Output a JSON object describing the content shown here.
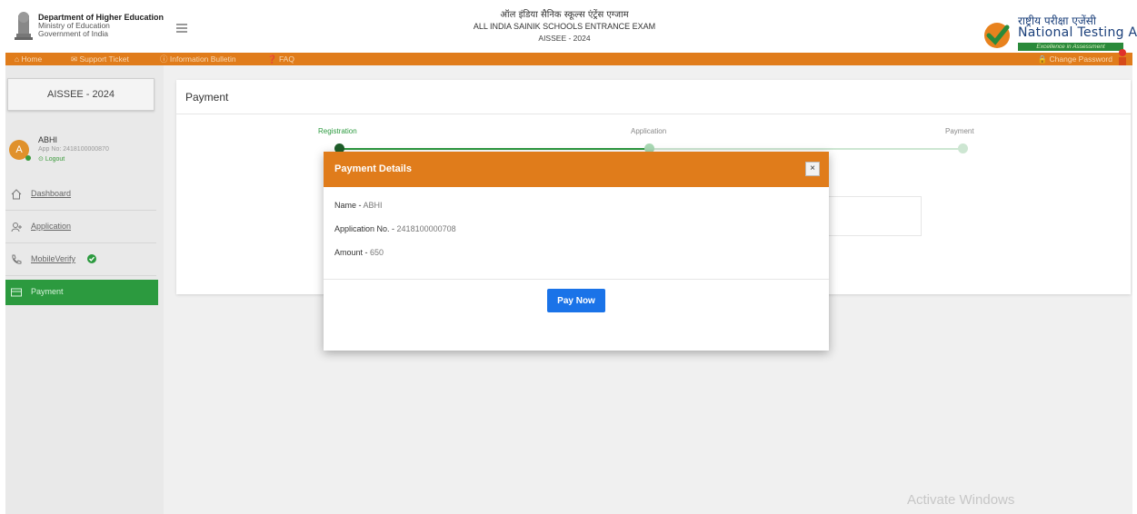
{
  "header": {
    "dept_line1": "Department of Higher Education",
    "dept_line2": "Ministry of Education",
    "dept_line3": "Government of India",
    "exam_hindi": "ऑल इंडिया सैनिक स्कूल्स एंट्रेंस एग्जाम",
    "exam_english": "ALL INDIA SAINIK SCHOOLS ENTRANCE EXAM",
    "exam_code": "AISSEE - 2024",
    "nta_hindi": "राष्ट्रीय परीक्षा एजेंसी",
    "nta_english": "National Testing Agency",
    "nta_tagline": "Excellence in Assessment"
  },
  "navbar": {
    "home": "Home",
    "support_ticket": "Support Ticket",
    "info_bulletin": "Information Bulletin",
    "faq": "FAQ",
    "change_password": "Change Password",
    "accent_color": "#e07c1b"
  },
  "sidebar": {
    "exam_box": "AISSEE - 2024",
    "user": {
      "initial": "A",
      "name": "ABHI",
      "app_no": "App No: 2418100000870",
      "logout": "Logout"
    },
    "items": [
      {
        "label": "Dashboard",
        "icon": "home-icon"
      },
      {
        "label": "Application",
        "icon": "user-plus-icon"
      },
      {
        "label": "MobileVerify",
        "icon": "phone-icon"
      },
      {
        "label": "Payment",
        "icon": "card-icon",
        "active": true
      }
    ],
    "active_color": "#2c9a3f"
  },
  "main": {
    "title": "Payment",
    "steps": [
      "Registration",
      "Application",
      "Payment"
    ]
  },
  "modal": {
    "title": "Payment Details",
    "close": "×",
    "name_label": "Name",
    "name_value": "ABHI",
    "app_label": "Application No.",
    "app_value": "2418100000708",
    "amount_label": "Amount",
    "amount_value": "650",
    "separator": " - ",
    "button": "Pay Now",
    "button_color": "#1a73e8"
  },
  "watermark": "Activate Windows"
}
